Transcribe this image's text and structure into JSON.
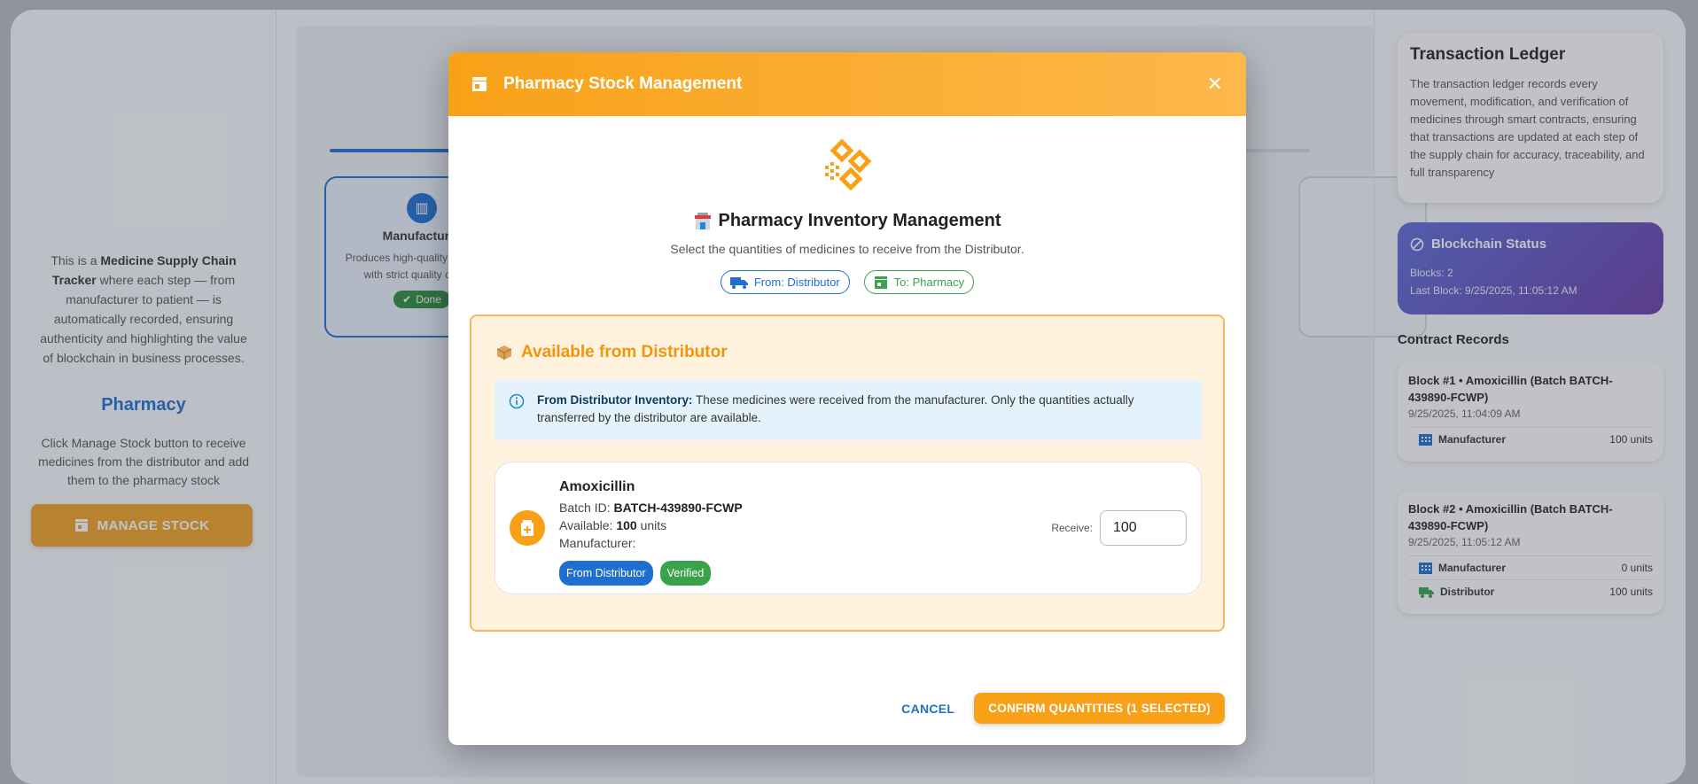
{
  "left": {
    "intro_pre": "This is a ",
    "intro_bold": "Medicine Supply Chain Tracker",
    "intro_post": " where each step — from manufacturer to patient — is automatically recorded, ensuring authenticity and highlighting the value of blockchain in business processes.",
    "role_title": "Pharmacy",
    "role_desc": "Click Manage Stock button to receive medicines from the distributor and add them to the pharmacy stock",
    "manage_button": "MANAGE STOCK"
  },
  "center": {
    "step": {
      "title": "Manufacturer",
      "desc": "Produces high-quality medicines with strict quality control.",
      "status": "Done"
    }
  },
  "right": {
    "ledger_title": "Transaction Ledger",
    "ledger_text": "The transaction ledger records every movement, modification, and verification of medicines through smart contracts, ensuring that transactions are updated at each step of the supply chain for accuracy, traceability, and full transparency",
    "chain_title": "Blockchain Status",
    "blocks_line": "Blocks: 2",
    "last_block_line": "Last Block: 9/25/2025, 11:05:12 AM",
    "records_title": "Contract Records",
    "records": [
      {
        "title": "Block #1 • Amoxicillin (Batch BATCH-439890-FCWP)",
        "time": "9/25/2025, 11:04:09 AM",
        "rows": [
          {
            "who": "Manufacturer",
            "qty": "100 units"
          }
        ]
      },
      {
        "title": "Block #2 • Amoxicillin (Batch BATCH-439890-FCWP)",
        "time": "9/25/2025, 11:05:12 AM",
        "rows": [
          {
            "who": "Manufacturer",
            "qty": "0 units"
          },
          {
            "who": "Distributor",
            "qty": "100 units"
          }
        ]
      }
    ]
  },
  "modal": {
    "header_title": "Pharmacy Stock Management",
    "hero_title": "Pharmacy Inventory Management",
    "hero_sub": "Select the quantities of medicines to receive from the Distributor.",
    "chip_from": "From: Distributor",
    "chip_to": "To: Pharmacy",
    "section_title": "Available from Distributor",
    "info_bold": "From Distributor Inventory:",
    "info_text": " These medicines were received from the manufacturer. Only the quantities actually transferred by the distributor are available.",
    "medicine": {
      "name": "Amoxicillin",
      "batch_label": "Batch ID: ",
      "batch_id": "BATCH-439890-FCWP",
      "available_label": "Available: ",
      "available_qty": "100",
      "available_unit": " units",
      "manufacturer_label": "Manufacturer:",
      "badge_from": "From Distributor",
      "badge_verified": "Verified",
      "receive_label": "Receive:",
      "receive_value": "100"
    },
    "cancel": "CANCEL",
    "confirm": "CONFIRM QUANTITIES (1 SELECTED)"
  },
  "colors": {
    "accent_orange": "#f8a118",
    "primary_blue": "#1e6fd1",
    "success_green": "#3aa24a",
    "chain_purple": "#6a3ba8"
  }
}
